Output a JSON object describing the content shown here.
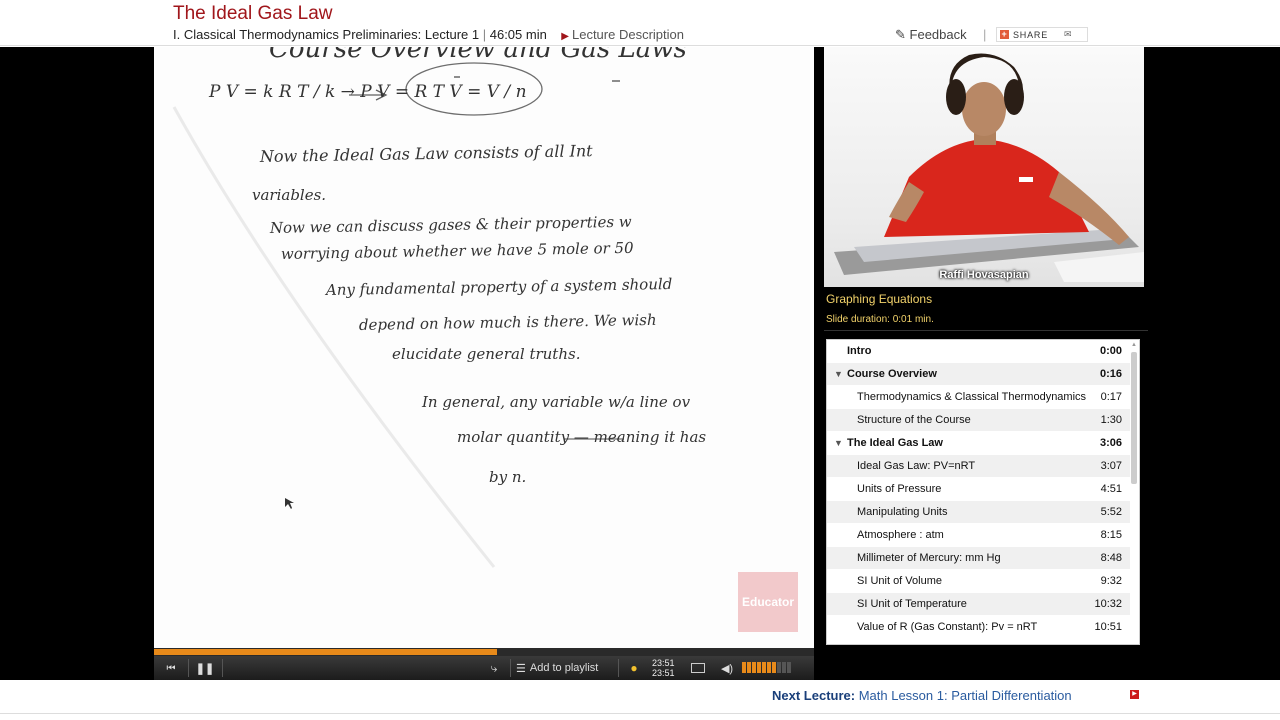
{
  "header": {
    "title": "The Ideal Gas Law",
    "course": "I. Classical Thermodynamics Preliminaries: Lecture 1",
    "separator": "|",
    "duration": "46:05 min",
    "description_link": "Lecture Description",
    "feedback": "Feedback",
    "share": "SHARE"
  },
  "slide": {
    "heading": "Course Overview and Gas Laws",
    "watermark": "Educator",
    "lines": [
      "P V = k R T / k    →    P V = R T        V = V / n",
      "Now the Ideal Gas Law consists of all Int",
      "variables.",
      "Now we can discuss gases & their properties w",
      "worrying about whether we have 5 mole or 50",
      "Any fundamental property of a system should",
      "depend on how much is there. We wish",
      "elucidate general truths.",
      "In general, any variable w/a line ov",
      "molar quantity — meaning it has",
      "by n."
    ]
  },
  "player": {
    "progress": 0.52,
    "current_time": "23:51",
    "total_time": "23:51",
    "add_to_playlist": "Add to playlist",
    "volume_level": 0.7
  },
  "video": {
    "presenter": "Raffi Hovasapian"
  },
  "slide_info": {
    "title": "Graphing Equations",
    "duration": "Slide duration: 0:01 min."
  },
  "chapters": [
    {
      "label": "Intro",
      "time": "0:00",
      "kind": "chapter",
      "toggle": ""
    },
    {
      "label": "Course Overview",
      "time": "0:16",
      "kind": "chapter",
      "toggle": "▼"
    },
    {
      "label": "Thermodynamics & Classical Thermodynamics",
      "time": "0:17",
      "kind": "sub",
      "toggle": ""
    },
    {
      "label": "Structure of the Course",
      "time": "1:30",
      "kind": "sub",
      "toggle": ""
    },
    {
      "label": "The Ideal Gas Law",
      "time": "3:06",
      "kind": "chapter",
      "toggle": "▼"
    },
    {
      "label": "Ideal Gas Law: PV=nRT",
      "time": "3:07",
      "kind": "sub",
      "toggle": ""
    },
    {
      "label": "Units of Pressure",
      "time": "4:51",
      "kind": "sub",
      "toggle": ""
    },
    {
      "label": "Manipulating Units",
      "time": "5:52",
      "kind": "sub",
      "toggle": ""
    },
    {
      "label": "Atmosphere : atm",
      "time": "8:15",
      "kind": "sub",
      "toggle": ""
    },
    {
      "label": "Millimeter of Mercury: mm Hg",
      "time": "8:48",
      "kind": "sub",
      "toggle": ""
    },
    {
      "label": "SI Unit of Volume",
      "time": "9:32",
      "kind": "sub",
      "toggle": ""
    },
    {
      "label": "SI Unit of Temperature",
      "time": "10:32",
      "kind": "sub",
      "toggle": ""
    },
    {
      "label": "Value of R (Gas Constant): Pv = nRT",
      "time": "10:51",
      "kind": "sub",
      "toggle": ""
    }
  ],
  "footer": {
    "next_label": "Next Lecture:",
    "next_title": "Math Lesson 1: Partial Differentiation"
  },
  "colors": {
    "brand_red": "#a0161b",
    "progress_orange": "#e88a1a",
    "slide_info_yellow": "#f3d36b",
    "link_blue": "#2a5b9f"
  }
}
